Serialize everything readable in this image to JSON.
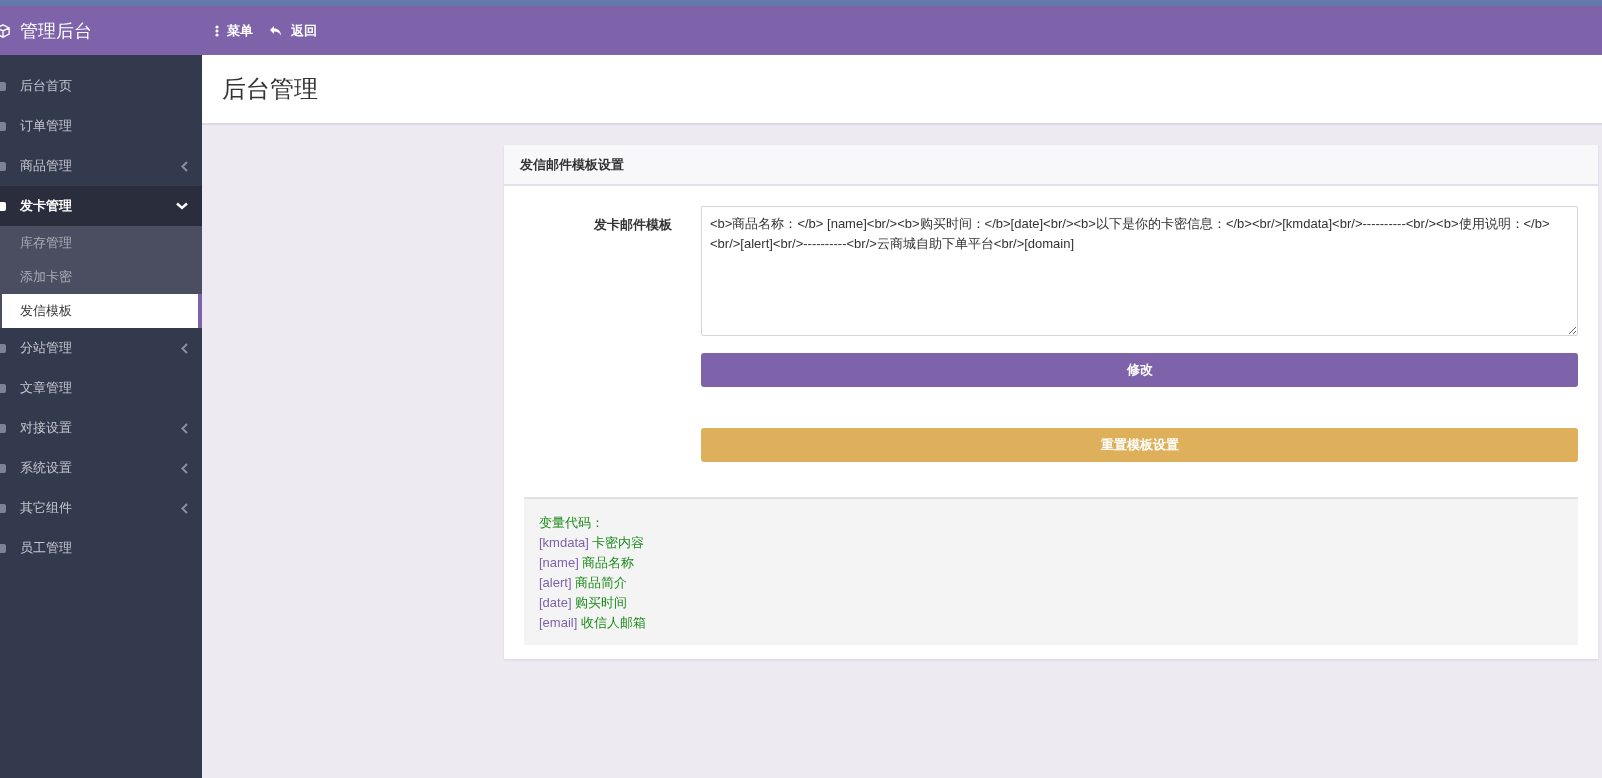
{
  "header": {
    "brand": "管理后台",
    "menu_label": "菜单",
    "back_label": "返回"
  },
  "sidebar": {
    "items": [
      {
        "label": "后台首页",
        "expandable": false,
        "expanded": false
      },
      {
        "label": "订单管理",
        "expandable": false,
        "expanded": false
      },
      {
        "label": "商品管理",
        "expandable": true,
        "expanded": false
      },
      {
        "label": "发卡管理",
        "expandable": true,
        "expanded": true,
        "children": [
          {
            "label": "库存管理",
            "selected": false
          },
          {
            "label": "添加卡密",
            "selected": false
          },
          {
            "label": "发信模板",
            "selected": true
          }
        ]
      },
      {
        "label": "分站管理",
        "expandable": true,
        "expanded": false
      },
      {
        "label": "文章管理",
        "expandable": false,
        "expanded": false
      },
      {
        "label": "对接设置",
        "expandable": true,
        "expanded": false
      },
      {
        "label": "系统设置",
        "expandable": true,
        "expanded": false
      },
      {
        "label": "其它组件",
        "expandable": true,
        "expanded": false
      },
      {
        "label": "员工管理",
        "expandable": false,
        "expanded": false
      }
    ]
  },
  "page_title": "后台管理",
  "card": {
    "title": "发信邮件模板设置",
    "field_label": "发卡邮件模板",
    "template_value": "<b>商品名称：</b> [name]<br/><b>购买时间：</b>[date]<br/><b>以下是你的卡密信息：</b><br/>[kmdata]<br/>----------<br/><b>使用说明：</b><br/>[alert]<br/>----------<br/>云商城自助下单平台<br/>[domain]",
    "save_button": "修改",
    "reset_button": "重置模板设置",
    "variables_heading": "变量代码：",
    "variables": [
      {
        "code": "[kmdata]",
        "description": "卡密内容"
      },
      {
        "code": "[name]",
        "description": "商品名称"
      },
      {
        "code": "[alert]",
        "description": "商品简介"
      },
      {
        "code": "[date]",
        "description": "购买时间"
      },
      {
        "code": "[email]",
        "description": "收信人邮箱"
      }
    ]
  }
}
